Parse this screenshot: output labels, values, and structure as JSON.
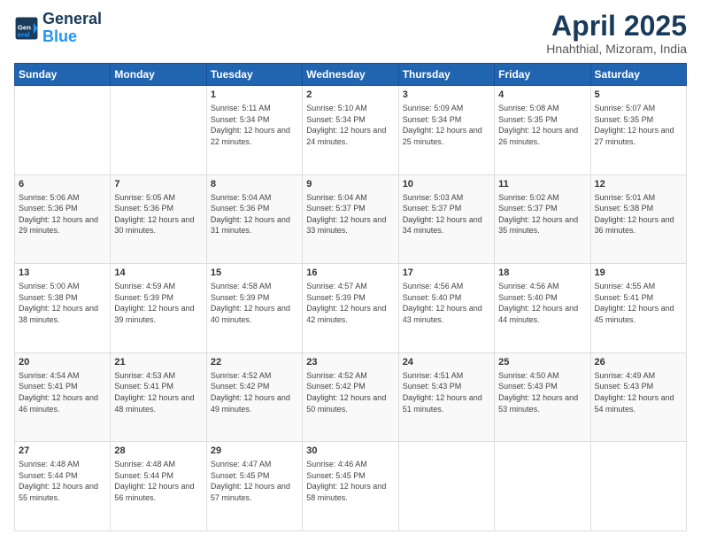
{
  "header": {
    "logo_line1": "General",
    "logo_line2": "Blue",
    "month": "April 2025",
    "location": "Hnahthial, Mizoram, India"
  },
  "weekdays": [
    "Sunday",
    "Monday",
    "Tuesday",
    "Wednesday",
    "Thursday",
    "Friday",
    "Saturday"
  ],
  "weeks": [
    [
      {
        "day": "",
        "sunrise": "",
        "sunset": "",
        "daylight": ""
      },
      {
        "day": "",
        "sunrise": "",
        "sunset": "",
        "daylight": ""
      },
      {
        "day": "1",
        "sunrise": "Sunrise: 5:11 AM",
        "sunset": "Sunset: 5:34 PM",
        "daylight": "Daylight: 12 hours and 22 minutes."
      },
      {
        "day": "2",
        "sunrise": "Sunrise: 5:10 AM",
        "sunset": "Sunset: 5:34 PM",
        "daylight": "Daylight: 12 hours and 24 minutes."
      },
      {
        "day": "3",
        "sunrise": "Sunrise: 5:09 AM",
        "sunset": "Sunset: 5:34 PM",
        "daylight": "Daylight: 12 hours and 25 minutes."
      },
      {
        "day": "4",
        "sunrise": "Sunrise: 5:08 AM",
        "sunset": "Sunset: 5:35 PM",
        "daylight": "Daylight: 12 hours and 26 minutes."
      },
      {
        "day": "5",
        "sunrise": "Sunrise: 5:07 AM",
        "sunset": "Sunset: 5:35 PM",
        "daylight": "Daylight: 12 hours and 27 minutes."
      }
    ],
    [
      {
        "day": "6",
        "sunrise": "Sunrise: 5:06 AM",
        "sunset": "Sunset: 5:36 PM",
        "daylight": "Daylight: 12 hours and 29 minutes."
      },
      {
        "day": "7",
        "sunrise": "Sunrise: 5:05 AM",
        "sunset": "Sunset: 5:36 PM",
        "daylight": "Daylight: 12 hours and 30 minutes."
      },
      {
        "day": "8",
        "sunrise": "Sunrise: 5:04 AM",
        "sunset": "Sunset: 5:36 PM",
        "daylight": "Daylight: 12 hours and 31 minutes."
      },
      {
        "day": "9",
        "sunrise": "Sunrise: 5:04 AM",
        "sunset": "Sunset: 5:37 PM",
        "daylight": "Daylight: 12 hours and 33 minutes."
      },
      {
        "day": "10",
        "sunrise": "Sunrise: 5:03 AM",
        "sunset": "Sunset: 5:37 PM",
        "daylight": "Daylight: 12 hours and 34 minutes."
      },
      {
        "day": "11",
        "sunrise": "Sunrise: 5:02 AM",
        "sunset": "Sunset: 5:37 PM",
        "daylight": "Daylight: 12 hours and 35 minutes."
      },
      {
        "day": "12",
        "sunrise": "Sunrise: 5:01 AM",
        "sunset": "Sunset: 5:38 PM",
        "daylight": "Daylight: 12 hours and 36 minutes."
      }
    ],
    [
      {
        "day": "13",
        "sunrise": "Sunrise: 5:00 AM",
        "sunset": "Sunset: 5:38 PM",
        "daylight": "Daylight: 12 hours and 38 minutes."
      },
      {
        "day": "14",
        "sunrise": "Sunrise: 4:59 AM",
        "sunset": "Sunset: 5:39 PM",
        "daylight": "Daylight: 12 hours and 39 minutes."
      },
      {
        "day": "15",
        "sunrise": "Sunrise: 4:58 AM",
        "sunset": "Sunset: 5:39 PM",
        "daylight": "Daylight: 12 hours and 40 minutes."
      },
      {
        "day": "16",
        "sunrise": "Sunrise: 4:57 AM",
        "sunset": "Sunset: 5:39 PM",
        "daylight": "Daylight: 12 hours and 42 minutes."
      },
      {
        "day": "17",
        "sunrise": "Sunrise: 4:56 AM",
        "sunset": "Sunset: 5:40 PM",
        "daylight": "Daylight: 12 hours and 43 minutes."
      },
      {
        "day": "18",
        "sunrise": "Sunrise: 4:56 AM",
        "sunset": "Sunset: 5:40 PM",
        "daylight": "Daylight: 12 hours and 44 minutes."
      },
      {
        "day": "19",
        "sunrise": "Sunrise: 4:55 AM",
        "sunset": "Sunset: 5:41 PM",
        "daylight": "Daylight: 12 hours and 45 minutes."
      }
    ],
    [
      {
        "day": "20",
        "sunrise": "Sunrise: 4:54 AM",
        "sunset": "Sunset: 5:41 PM",
        "daylight": "Daylight: 12 hours and 46 minutes."
      },
      {
        "day": "21",
        "sunrise": "Sunrise: 4:53 AM",
        "sunset": "Sunset: 5:41 PM",
        "daylight": "Daylight: 12 hours and 48 minutes."
      },
      {
        "day": "22",
        "sunrise": "Sunrise: 4:52 AM",
        "sunset": "Sunset: 5:42 PM",
        "daylight": "Daylight: 12 hours and 49 minutes."
      },
      {
        "day": "23",
        "sunrise": "Sunrise: 4:52 AM",
        "sunset": "Sunset: 5:42 PM",
        "daylight": "Daylight: 12 hours and 50 minutes."
      },
      {
        "day": "24",
        "sunrise": "Sunrise: 4:51 AM",
        "sunset": "Sunset: 5:43 PM",
        "daylight": "Daylight: 12 hours and 51 minutes."
      },
      {
        "day": "25",
        "sunrise": "Sunrise: 4:50 AM",
        "sunset": "Sunset: 5:43 PM",
        "daylight": "Daylight: 12 hours and 53 minutes."
      },
      {
        "day": "26",
        "sunrise": "Sunrise: 4:49 AM",
        "sunset": "Sunset: 5:43 PM",
        "daylight": "Daylight: 12 hours and 54 minutes."
      }
    ],
    [
      {
        "day": "27",
        "sunrise": "Sunrise: 4:48 AM",
        "sunset": "Sunset: 5:44 PM",
        "daylight": "Daylight: 12 hours and 55 minutes."
      },
      {
        "day": "28",
        "sunrise": "Sunrise: 4:48 AM",
        "sunset": "Sunset: 5:44 PM",
        "daylight": "Daylight: 12 hours and 56 minutes."
      },
      {
        "day": "29",
        "sunrise": "Sunrise: 4:47 AM",
        "sunset": "Sunset: 5:45 PM",
        "daylight": "Daylight: 12 hours and 57 minutes."
      },
      {
        "day": "30",
        "sunrise": "Sunrise: 4:46 AM",
        "sunset": "Sunset: 5:45 PM",
        "daylight": "Daylight: 12 hours and 58 minutes."
      },
      {
        "day": "",
        "sunrise": "",
        "sunset": "",
        "daylight": ""
      },
      {
        "day": "",
        "sunrise": "",
        "sunset": "",
        "daylight": ""
      },
      {
        "day": "",
        "sunrise": "",
        "sunset": "",
        "daylight": ""
      }
    ]
  ]
}
